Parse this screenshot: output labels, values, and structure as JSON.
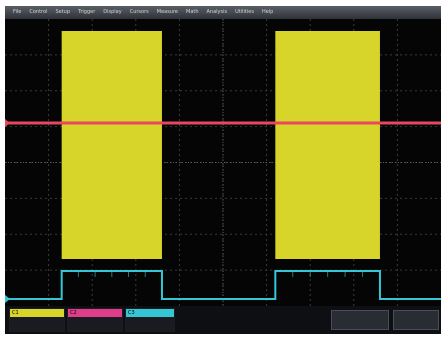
{
  "menu": {
    "items": [
      "File",
      "Control",
      "Setup",
      "Trigger",
      "Display",
      "Cursors",
      "Measure",
      "Math",
      "Analysis",
      "Utilities",
      "Help"
    ]
  },
  "colors": {
    "ch1": "#d7d42a",
    "ch2": "#e8475f",
    "ch3": "#35c6d6",
    "grid": "#3a3a3a",
    "background": "#050505"
  },
  "channels": [
    {
      "id": "ch1",
      "name": "C1",
      "color": "#d7d42a",
      "line1": "",
      "line2": ""
    },
    {
      "id": "ch2",
      "name": "C2",
      "color": "#e03c8c",
      "line1": "",
      "line2": ""
    },
    {
      "id": "ch3",
      "name": "C3",
      "color": "#35c6d6",
      "line1": "",
      "line2": ""
    }
  ],
  "timebase": {
    "line1": "",
    "line2": ""
  },
  "trigger": {
    "line1": "",
    "line2": ""
  },
  "status": {
    "left": "",
    "right": ""
  },
  "waveforms": {
    "ch1_bursts": [
      {
        "start_div": 1.3,
        "end_div": 3.6
      },
      {
        "start_div": 6.2,
        "end_div": 8.6
      }
    ],
    "ch2_level_div": 2.4,
    "ch3_pulses": [
      {
        "start_div": 1.3,
        "end_div": 3.6
      },
      {
        "start_div": 6.2,
        "end_div": 8.6
      }
    ]
  }
}
